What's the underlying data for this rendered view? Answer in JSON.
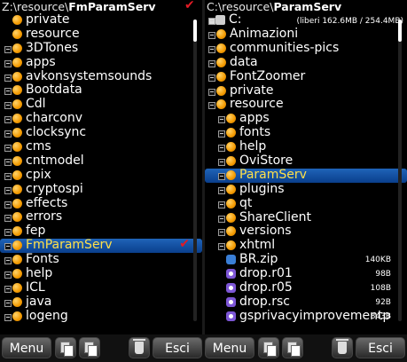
{
  "left": {
    "path_prefix": "Z:\\resource\\",
    "path_name": "FmParamServ",
    "items": [
      {
        "label": "private",
        "type": "folder",
        "expander": false
      },
      {
        "label": "resource",
        "type": "folder",
        "expander": false
      },
      {
        "label": "3DTones",
        "type": "folder",
        "expander": true
      },
      {
        "label": "apps",
        "type": "folder",
        "expander": true
      },
      {
        "label": "avkonsystemsounds",
        "type": "folder",
        "expander": true
      },
      {
        "label": "Bootdata",
        "type": "folder",
        "expander": true
      },
      {
        "label": "Cdl",
        "type": "folder",
        "expander": true
      },
      {
        "label": "charconv",
        "type": "folder",
        "expander": true
      },
      {
        "label": "clocksync",
        "type": "folder",
        "expander": true
      },
      {
        "label": "cms",
        "type": "folder",
        "expander": true
      },
      {
        "label": "cntmodel",
        "type": "folder",
        "expander": true
      },
      {
        "label": "cpix",
        "type": "folder",
        "expander": true
      },
      {
        "label": "cryptospi",
        "type": "folder",
        "expander": true
      },
      {
        "label": "effects",
        "type": "folder",
        "expander": true
      },
      {
        "label": "errors",
        "type": "folder",
        "expander": true
      },
      {
        "label": "fep",
        "type": "folder",
        "expander": true
      },
      {
        "label": "FmParamServ",
        "type": "folder",
        "expander": true,
        "selected": true,
        "checked": true
      },
      {
        "label": "Fonts",
        "type": "folder",
        "expander": true
      },
      {
        "label": "help",
        "type": "folder",
        "expander": true
      },
      {
        "label": "ICL",
        "type": "folder",
        "expander": true
      },
      {
        "label": "java",
        "type": "folder",
        "expander": true
      },
      {
        "label": "logeng",
        "type": "folder",
        "expander": true
      }
    ]
  },
  "right": {
    "path_prefix": "C:\\resource\\",
    "path_name": "ParamServ",
    "drive": "C:",
    "free_space": "(liberi 162.6MB / 254.4MB)",
    "items": [
      {
        "label": "Animazioni",
        "type": "folder",
        "expander": true,
        "indent": 1
      },
      {
        "label": "communities-pics",
        "type": "folder",
        "expander": true,
        "indent": 1
      },
      {
        "label": "data",
        "type": "folder",
        "expander": true,
        "indent": 1
      },
      {
        "label": "FontZoomer",
        "type": "folder",
        "expander": true,
        "indent": 1
      },
      {
        "label": "private",
        "type": "folder",
        "expander": true,
        "indent": 1
      },
      {
        "label": "resource",
        "type": "folder",
        "expander": true,
        "indent": 1
      },
      {
        "label": "apps",
        "type": "folder",
        "expander": true,
        "indent": 2
      },
      {
        "label": "fonts",
        "type": "folder",
        "expander": true,
        "indent": 2
      },
      {
        "label": "help",
        "type": "folder",
        "expander": true,
        "indent": 2
      },
      {
        "label": "OviStore",
        "type": "folder",
        "expander": true,
        "indent": 2
      },
      {
        "label": "ParamServ",
        "type": "folder",
        "expander": true,
        "indent": 2,
        "selected": true
      },
      {
        "label": "plugins",
        "type": "folder",
        "expander": true,
        "indent": 2
      },
      {
        "label": "qt",
        "type": "folder",
        "expander": true,
        "indent": 2
      },
      {
        "label": "ShareClient",
        "type": "folder",
        "expander": true,
        "indent": 2
      },
      {
        "label": "versions",
        "type": "folder",
        "expander": true,
        "indent": 2
      },
      {
        "label": "xhtml",
        "type": "folder",
        "expander": true,
        "indent": 2
      },
      {
        "label": "BR.zip",
        "type": "zip",
        "size": "140KB",
        "indent": 2
      },
      {
        "label": "drop.r01",
        "type": "file",
        "size": "98B",
        "indent": 2
      },
      {
        "label": "drop.r05",
        "type": "file",
        "size": "108B",
        "indent": 2
      },
      {
        "label": "drop.rsc",
        "type": "file",
        "size": "92B",
        "indent": 2
      },
      {
        "label": "gsprivacyimprovementp",
        "type": "file",
        "size": "843B",
        "indent": 2
      }
    ]
  },
  "toolbar": {
    "left_menu": "Menu",
    "left_exit": "Esci",
    "right_menu": "Menu",
    "right_exit": "Esci"
  },
  "scroll": {
    "left_position": 0,
    "right_position": 0
  },
  "colors": {
    "selection": "#1a56a8",
    "selection_text": "#ffe04a",
    "check": "#e21b25",
    "folder": "#f5a300"
  }
}
